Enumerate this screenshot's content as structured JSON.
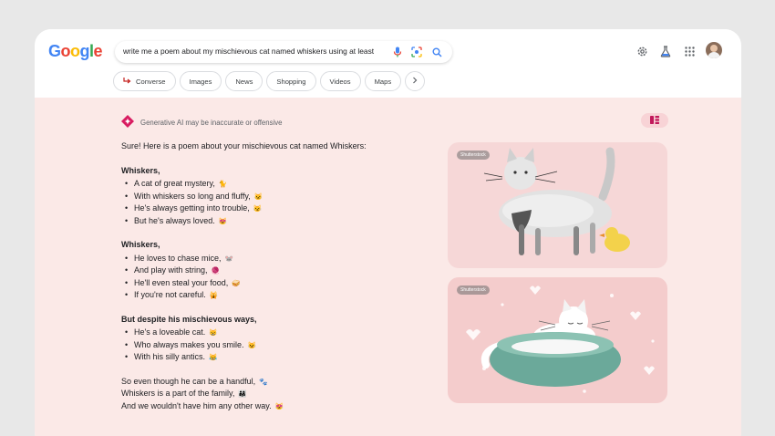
{
  "logo": {
    "letters": [
      "G",
      "o",
      "o",
      "g",
      "l",
      "e"
    ],
    "colors": [
      "#4285F4",
      "#EA4335",
      "#FBBC05",
      "#4285F4",
      "#34A853",
      "#EA4335"
    ]
  },
  "search": {
    "query": "write me a poem about my mischievous cat named whiskers using at least"
  },
  "header_icons": [
    "settings-icon",
    "labs-flask-icon",
    "apps-grid-icon",
    "account-avatar"
  ],
  "chips": [
    {
      "label": "Converse",
      "icon": "converse-arrow-icon"
    },
    {
      "label": "Images"
    },
    {
      "label": "News"
    },
    {
      "label": "Shopping"
    },
    {
      "label": "Videos"
    },
    {
      "label": "Maps"
    }
  ],
  "sge": {
    "disclaimer": "Generative AI may be inaccurate or offensive"
  },
  "answer": {
    "intro": "Sure! Here is a poem about your mischievous cat named Whiskers:",
    "stanzas": [
      {
        "title": "Whiskers,",
        "lines": [
          "A cat of great mystery,",
          "With whiskers so long and fluffy,",
          "He's always getting into trouble,",
          "But he's always loved."
        ],
        "emoji": [
          "🐈",
          "🐱",
          "😼",
          "😻"
        ]
      },
      {
        "title": "Whiskers,",
        "lines": [
          "He loves to chase mice,",
          "And play with string,",
          "He'll even steal your food,",
          "If you're not careful."
        ],
        "emoji": [
          "🐭",
          "🧶",
          "🥪",
          "🙀"
        ]
      },
      {
        "title": "But despite his mischievous ways,",
        "lines": [
          "He's a loveable cat.",
          "Who always makes you smile.",
          "With his silly antics."
        ],
        "emoji": [
          "😸",
          "😺",
          "😹"
        ]
      }
    ],
    "closing": [
      "So even though he can be a handful,",
      "Whiskers is a part of the family,",
      "And we wouldn't have him any other way."
    ],
    "closing_emoji": [
      "🐾",
      "👨‍👩‍👧",
      "😻"
    ]
  },
  "images": [
    {
      "badge": "Shutterstock",
      "subject": "watercolor-cat-with-rubber-duck"
    },
    {
      "badge": "Shutterstock",
      "subject": "cat-sleeping-in-teal-bed"
    }
  ],
  "colors": {
    "page_bg": "#e8e8e8",
    "content_bg": "#fbe9e7",
    "accent": "#c2185b"
  }
}
